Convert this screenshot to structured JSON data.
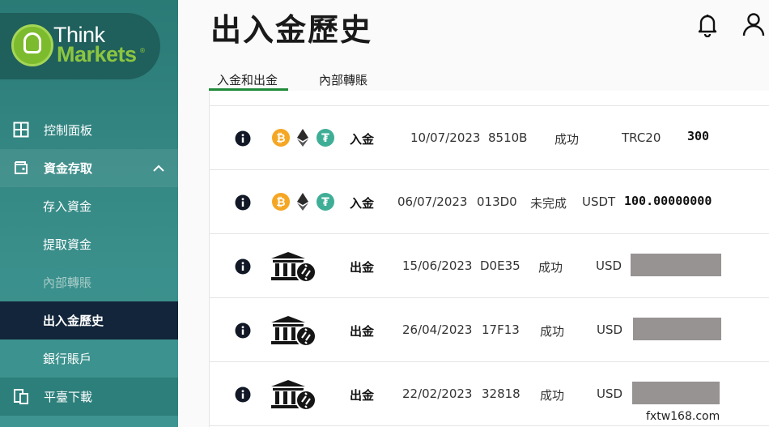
{
  "brand": {
    "name_line1": "Think",
    "name_line2": "Markets",
    "registered": "®"
  },
  "sidebar": {
    "items": [
      {
        "label": "控制面板",
        "icon": "dashboard-grid-icon"
      },
      {
        "label": "資金存取",
        "icon": "wallet-icon"
      },
      {
        "label": "存入資金"
      },
      {
        "label": "提取資金"
      },
      {
        "label": "內部轉賬"
      },
      {
        "label": "出入金歷史"
      },
      {
        "label": "銀行賬戶"
      },
      {
        "label": "平臺下載",
        "icon": "download-device-icon"
      }
    ]
  },
  "header": {
    "title": "出入金歷史"
  },
  "tabs": [
    {
      "label": "入金和出金",
      "active": true
    },
    {
      "label": "內部轉賬",
      "active": false
    }
  ],
  "rows": [
    {
      "type": "入金",
      "date": "10/07/2023",
      "id": "8510B",
      "status": "成功",
      "currency": "TRC20",
      "amount": "300",
      "method": "crypto"
    },
    {
      "type": "入金",
      "date": "06/07/2023",
      "id": "013D0",
      "status": "未完成",
      "currency": "USDT",
      "amount": "100.00000000",
      "method": "crypto"
    },
    {
      "type": "出金",
      "date": "15/06/2023",
      "id": "D0E35",
      "status": "成功",
      "currency": "USD",
      "amount": null,
      "method": "bank"
    },
    {
      "type": "出金",
      "date": "26/04/2023",
      "id": "17F13",
      "status": "成功",
      "currency": "USD",
      "amount": null,
      "method": "bank"
    },
    {
      "type": "出金",
      "date": "22/02/2023",
      "id": "32818",
      "status": "成功",
      "currency": "USD",
      "amount": null,
      "method": "bank"
    }
  ],
  "watermark": "fxtw168.com",
  "colors": {
    "sidebar": "#2a7a76",
    "active_nav": "#12253a",
    "tab_underline": "#1f8a3a",
    "brand_green": "#8cc63f"
  }
}
